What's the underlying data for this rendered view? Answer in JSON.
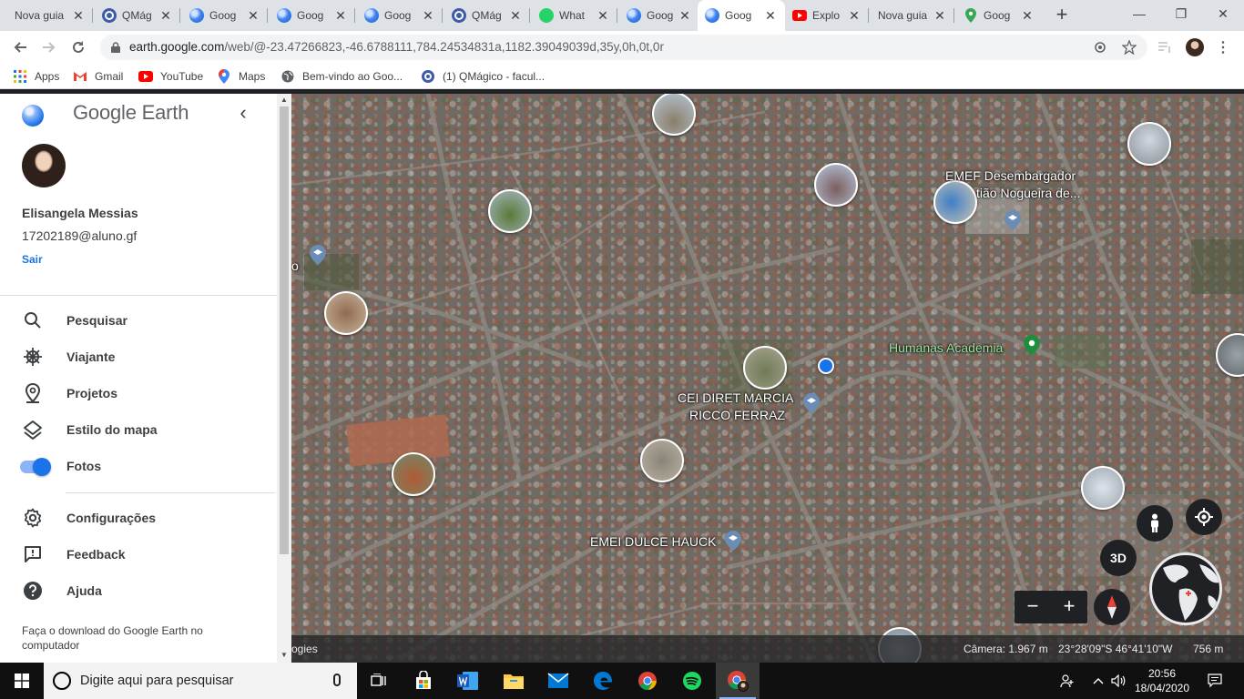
{
  "browser": {
    "tabs": [
      {
        "title": "Nova guia",
        "icon": "new-tab-icon"
      },
      {
        "title": "QMág",
        "icon": "qmagico-icon"
      },
      {
        "title": "Goog",
        "icon": "google-earth-icon"
      },
      {
        "title": "Goog",
        "icon": "google-earth-icon"
      },
      {
        "title": "Goog",
        "icon": "google-earth-icon"
      },
      {
        "title": "QMág",
        "icon": "qmagico-icon"
      },
      {
        "title": "What",
        "icon": "whatsapp-icon"
      },
      {
        "title": "Goog",
        "icon": "google-earth-icon"
      },
      {
        "title": "Goog",
        "icon": "google-earth-icon",
        "active": true
      },
      {
        "title": "Explo",
        "icon": "youtube-icon"
      },
      {
        "title": "Nova guia",
        "icon": "new-tab-icon"
      },
      {
        "title": "Goog",
        "icon": "google-maps-icon"
      }
    ],
    "url_host": "earth.google.com",
    "url_path": "/web/@-23.47266823,-46.6788111,784.24534831a,1182.39049039d,35y,0h,0t,0r",
    "bookmarks": [
      {
        "label": "Apps",
        "icon": "apps-grid-icon"
      },
      {
        "label": "Gmail",
        "icon": "gmail-icon"
      },
      {
        "label": "YouTube",
        "icon": "youtube-icon"
      },
      {
        "label": "Maps",
        "icon": "google-maps-icon"
      },
      {
        "label": "Bem-vindo ao Goo...",
        "icon": "globe-icon"
      },
      {
        "label": "(1) QMágico - facul...",
        "icon": "qmagico-icon"
      }
    ]
  },
  "panel": {
    "brand": "Google Earth",
    "user_name": "Elisangela Messias",
    "user_email": "17202189@aluno.gf",
    "sign_out": "Sair",
    "menu": [
      {
        "label": "Pesquisar",
        "icon": "search-icon"
      },
      {
        "label": "Viajante",
        "icon": "ship-wheel-icon"
      },
      {
        "label": "Projetos",
        "icon": "map-pin-icon"
      },
      {
        "label": "Estilo do mapa",
        "icon": "layers-icon"
      },
      {
        "label": "Fotos",
        "icon": "toggle-switch",
        "toggle_on": true
      }
    ],
    "menu2": [
      {
        "label": "Configurações",
        "icon": "settings-gear-icon"
      },
      {
        "label": "Feedback",
        "icon": "feedback-icon"
      },
      {
        "label": "Ajuda",
        "icon": "help-icon"
      }
    ],
    "download_text": "Faça o download do Google Earth no computador"
  },
  "map": {
    "labels": [
      {
        "text": "EMEF Desembargador",
        "kind": "school"
      },
      {
        "text": "tião Nogueira de...",
        "kind": "school"
      },
      {
        "text": "Humanas Academia",
        "kind": "place"
      },
      {
        "text": "CEI DIRET MARCIA",
        "kind": "school"
      },
      {
        "text": "RICCO FERRAZ",
        "kind": "school"
      },
      {
        "text": "EMEI DULCE HAUCK",
        "kind": "school"
      },
      {
        "text": "o",
        "kind": "partial"
      }
    ],
    "three_d_label": "3D",
    "zoom_out_label": "−",
    "zoom_in_label": "+",
    "status": {
      "attribution": "ogies",
      "camera": "Câmera: 1.967 m",
      "coords": "23°28'09\"S 46°41'10\"W",
      "scale": "756 m"
    }
  },
  "taskbar": {
    "search_placeholder": "Digite aqui para pesquisar",
    "apps": [
      "task-view-icon",
      "store-icon",
      "word-icon",
      "file-explorer-icon",
      "mail-icon",
      "edge-icon",
      "chrome-icon",
      "spotify-icon",
      "chrome-profile-icon"
    ],
    "time": "20:56",
    "date": "18/04/2020"
  }
}
